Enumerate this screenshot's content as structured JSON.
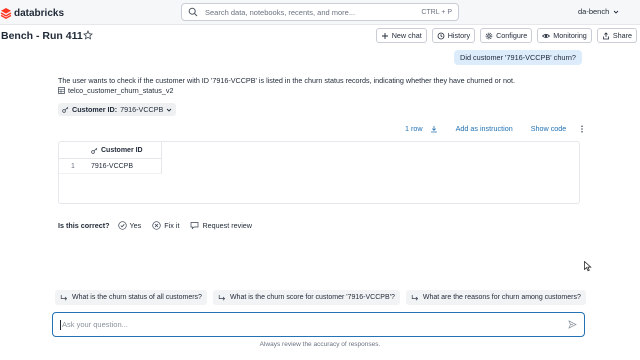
{
  "app": {
    "logo_text": "databricks",
    "brand_color": "#ff3621"
  },
  "search": {
    "placeholder": "Search data, notebooks, recents, and more...",
    "shortcut": "CTRL + P"
  },
  "workspace": {
    "name": "da-bench"
  },
  "header": {
    "title": "Bench - Run 411",
    "buttons": [
      {
        "label": "New chat",
        "icon": "plus-icon"
      },
      {
        "label": "History",
        "icon": "history-icon"
      },
      {
        "label": "Configure",
        "icon": "gear-icon"
      },
      {
        "label": "Monitoring",
        "icon": "eye-icon"
      },
      {
        "label": "Share",
        "icon": "share-icon"
      }
    ]
  },
  "conversation": {
    "user_message": "Did customer '7916-VCCPB' churn?",
    "assistant_text": "The user wants to check if the customer with ID '7916-VCCPB' is listed in the churn status records, indicating whether they have churned or not.",
    "table_ref": "telco_customer_churn_status_v2",
    "filter_label": "Customer ID:",
    "filter_value": "7916-VCCPB"
  },
  "result": {
    "row_count": "1 row",
    "add_instruction": "Add as instruction",
    "show_code": "Show code",
    "columns": [
      "Customer ID"
    ],
    "rows": [
      {
        "num": "1",
        "cells": [
          "7916-VCCPB"
        ]
      }
    ]
  },
  "feedback": {
    "question": "Is this correct?",
    "yes": "Yes",
    "fix": "Fix it",
    "review": "Request review"
  },
  "suggestions": [
    "What is the churn status of all customers?",
    "What is the churn score for customer '7916-VCCPB'?",
    "What are the reasons for churn among customers?"
  ],
  "input": {
    "placeholder": "Ask your question..."
  },
  "disclaimer": "Always review the accuracy of responses.",
  "colors": {
    "accent": "#2272b4",
    "user_bubble": "#dcecfb"
  }
}
